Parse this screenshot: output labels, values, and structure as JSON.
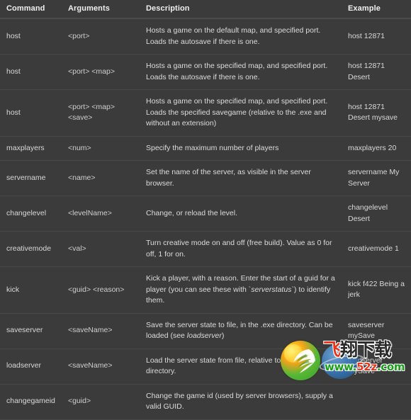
{
  "table": {
    "headers": {
      "command": "Command",
      "arguments": "Arguments",
      "description": "Description",
      "example": "Example"
    },
    "rows": [
      {
        "command": "host",
        "arguments": "<port>",
        "description": "Hosts a game on the default map, and specified port. Loads the autosave if there is one.",
        "example": "host 12871"
      },
      {
        "command": "host",
        "arguments": "<port> <map>",
        "description": "Hosts a game on the specified map, and specified port. Loads the autosave if there is one.",
        "example": "host 12871 Desert"
      },
      {
        "command": "host",
        "arguments": "<port> <map> <save>",
        "description": "Hosts a game on the specified map, and specified port. Loads the specified savegame (relative to the .exe and without an extension)",
        "example": "host 12871 Desert mysave"
      },
      {
        "command": "maxplayers",
        "arguments": "<num>",
        "description": "Specify the maximum number of players",
        "example": "maxplayers 20"
      },
      {
        "command": "servername",
        "arguments": "<name>",
        "description": "Set the name of the server, as visible in the server browser.",
        "example": "servername My Server"
      },
      {
        "command": "changelevel",
        "arguments": "<levelName>",
        "description": "Change, or reload the level.",
        "example": "changelevel Desert"
      },
      {
        "command": "creativemode",
        "arguments": "<val>",
        "description": "Turn creative mode on and off (free build). Value as 0 for off, 1 for on.",
        "example": "creativemode 1"
      },
      {
        "command": "kick",
        "arguments": "<guid> <reason>",
        "description_pre": "Kick a player, with a reason. Enter the start of a guid for a player (you can see these with `",
        "description_em": "serverstatus",
        "description_post": "`) to identify them.",
        "example": "kick f422 Being a jerk"
      },
      {
        "command": "saveserver",
        "arguments": "<saveName>",
        "description_pre": "Save the server state to file, in the .exe directory. Can be loaded (see ",
        "description_em": "loadserver",
        "description_post": ")",
        "example": "saveserver mySave"
      },
      {
        "command": "loadserver",
        "arguments": "<saveName>",
        "description": "Load the server state from file, relative to the .exe directory.",
        "example": "loadserver mySave"
      },
      {
        "command": "changegameid",
        "arguments": "<guid>",
        "description": "Change the game id (used by server browsers), supply a valid GUID.",
        "example": ""
      }
    ]
  },
  "watermark": {
    "brand_char1": "飞",
    "brand_rest": "翔下载",
    "url_part1": "www.",
    "url_part2": "52z",
    "url_part3": ".com",
    "logo_icon": "leaf-wing-sun-logo",
    "globe_icon": "globe-icon"
  },
  "colors": {
    "page_background": "#3b3b3b",
    "header_text": "#f0f0f0",
    "body_text": "#d6d6d6",
    "divider": "#484848",
    "header_divider": "#4b4b4b",
    "watermark_red": "#e8341c",
    "watermark_green": "#18a018",
    "logo_green": "#3aa02a",
    "logo_yellow": "#ffc21e"
  }
}
